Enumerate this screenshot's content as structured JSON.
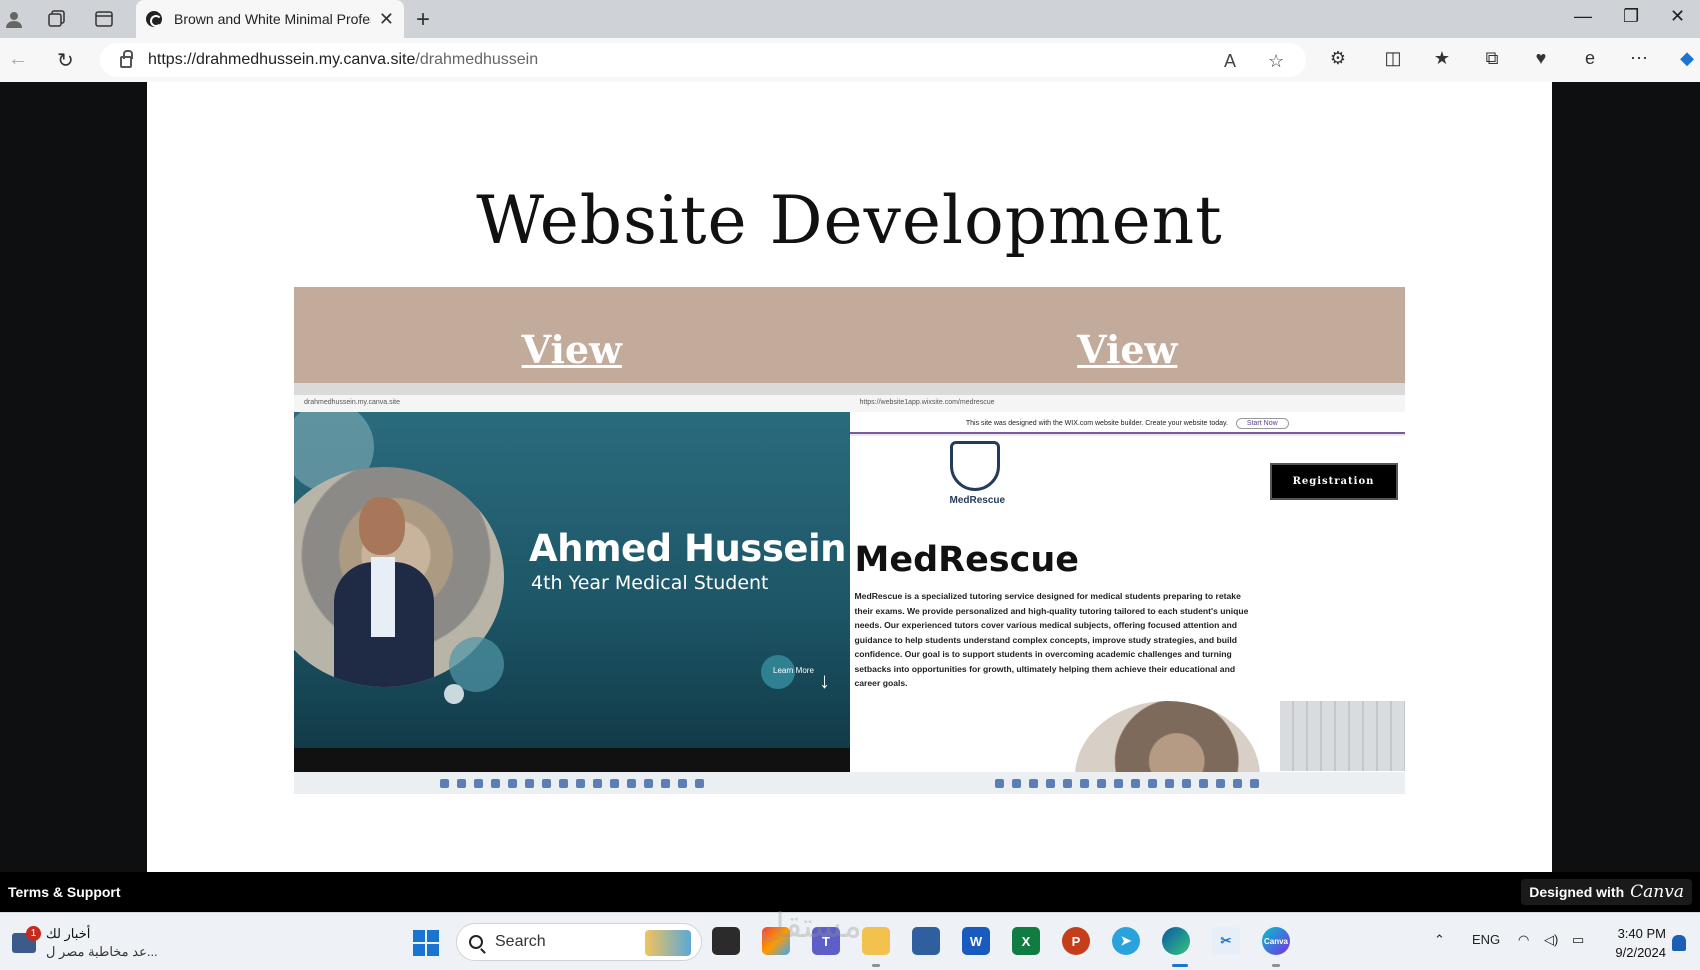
{
  "browser": {
    "tab_title": "Brown and White Minimal Profess",
    "url_host": "https://drahmedhussein.my.canva.site",
    "url_path": "/drahmedhussein"
  },
  "page": {
    "heading": "Website Development",
    "cards": [
      {
        "link_label": "View",
        "preview": {
          "mini_url": "drahmedhussein.my.canva.site",
          "name": "Ahmed Hussein",
          "subtitle": "4th Year Medical Student",
          "cta": "Learn More"
        }
      },
      {
        "link_label": "View",
        "preview": {
          "mini_url": "https://website1app.wixsite.com/medrescue",
          "wix_banner": "This site was designed with the WIX.com website builder. Create your website today.",
          "wix_button": "Start Now",
          "logo_text": "MedRescue",
          "register_label": "Registration",
          "title": "MedRescue",
          "description": "MedRescue is a specialized tutoring service designed for medical students preparing to retake their exams. We provide personalized and high-quality tutoring tailored to each student's unique needs. Our experienced tutors cover various medical subjects, offering focused attention and guidance to help students understand complex concepts, improve study strategies, and build confidence. Our goal is to support students in overcoming academic challenges and turning setbacks into opportunities for growth, ultimately helping them achieve their educational and career goals."
        }
      }
    ]
  },
  "footer": {
    "terms_label": "Terms & Support",
    "designed_label": "Designed with",
    "designed_brand": "Canva"
  },
  "taskbar": {
    "news_badge": "1",
    "news_title": "أخبار لك",
    "news_sub": "عد مخاطبة مصر ل...",
    "search_label": "Search",
    "lang": "ENG",
    "time": "3:40 PM",
    "date": "9/2/2024",
    "watermark": "مستقل"
  },
  "colors": {
    "card_band": "#c3ab9c",
    "hero_teal": "#1c5566",
    "accent_blue": "#1a74d2"
  }
}
